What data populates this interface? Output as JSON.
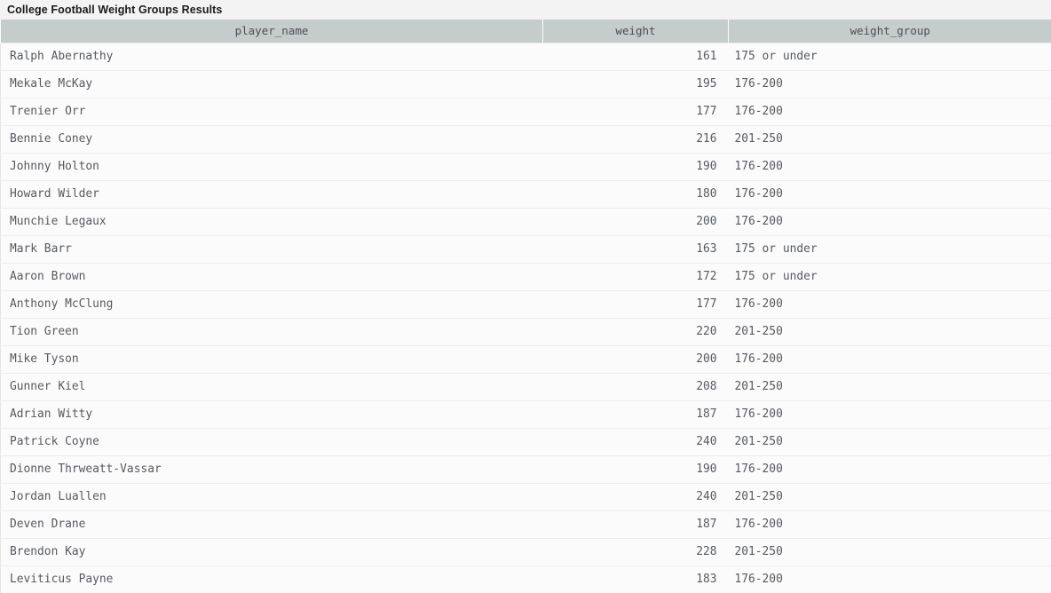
{
  "title": "College Football Weight Groups Results",
  "table": {
    "columns": [
      {
        "key": "player_name",
        "label": "player_name",
        "align": "left"
      },
      {
        "key": "weight",
        "label": "weight",
        "align": "right"
      },
      {
        "key": "weight_group",
        "label": "weight_group",
        "align": "left"
      }
    ],
    "rows": [
      {
        "player_name": "Ralph Abernathy",
        "weight": "161",
        "weight_group": "175 or under"
      },
      {
        "player_name": "Mekale McKay",
        "weight": "195",
        "weight_group": "176-200"
      },
      {
        "player_name": "Trenier Orr",
        "weight": "177",
        "weight_group": "176-200"
      },
      {
        "player_name": "Bennie Coney",
        "weight": "216",
        "weight_group": "201-250"
      },
      {
        "player_name": "Johnny Holton",
        "weight": "190",
        "weight_group": "176-200"
      },
      {
        "player_name": "Howard Wilder",
        "weight": "180",
        "weight_group": "176-200"
      },
      {
        "player_name": "Munchie Legaux",
        "weight": "200",
        "weight_group": "176-200"
      },
      {
        "player_name": "Mark Barr",
        "weight": "163",
        "weight_group": "175 or under"
      },
      {
        "player_name": "Aaron Brown",
        "weight": "172",
        "weight_group": "175 or under"
      },
      {
        "player_name": "Anthony McClung",
        "weight": "177",
        "weight_group": "176-200"
      },
      {
        "player_name": "Tion Green",
        "weight": "220",
        "weight_group": "201-250"
      },
      {
        "player_name": "Mike Tyson",
        "weight": "200",
        "weight_group": "176-200"
      },
      {
        "player_name": "Gunner Kiel",
        "weight": "208",
        "weight_group": "201-250"
      },
      {
        "player_name": "Adrian Witty",
        "weight": "187",
        "weight_group": "176-200"
      },
      {
        "player_name": "Patrick Coyne",
        "weight": "240",
        "weight_group": "201-250"
      },
      {
        "player_name": "Dionne Thrweatt-Vassar",
        "weight": "190",
        "weight_group": "176-200"
      },
      {
        "player_name": "Jordan Luallen",
        "weight": "240",
        "weight_group": "201-250"
      },
      {
        "player_name": "Deven Drane",
        "weight": "187",
        "weight_group": "176-200"
      },
      {
        "player_name": "Brendon Kay",
        "weight": "228",
        "weight_group": "201-250"
      },
      {
        "player_name": "Leviticus Payne",
        "weight": "183",
        "weight_group": "176-200"
      }
    ]
  },
  "colors": {
    "title_bar_bg": "#f2f3f2",
    "header_bg": "#c4cdcb",
    "row_bg": "#fbfbfb",
    "row_border": "#ededed",
    "text": "#555a61",
    "header_text": "#4b4f55"
  }
}
